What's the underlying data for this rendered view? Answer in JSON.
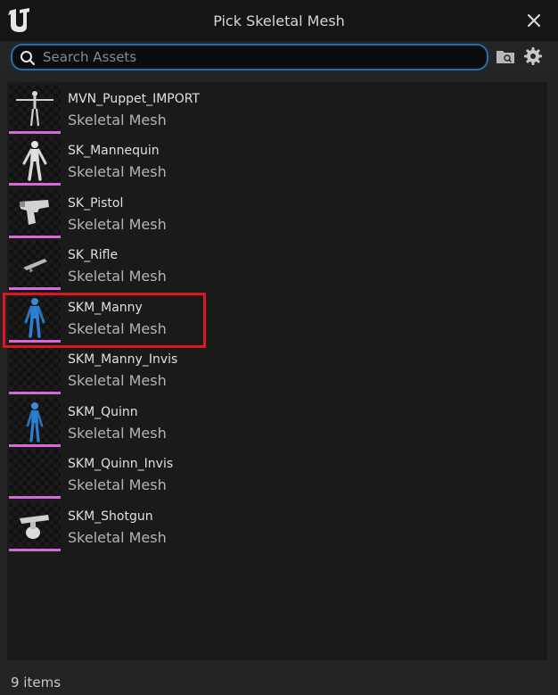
{
  "window": {
    "title": "Pick Skeletal Mesh"
  },
  "search": {
    "placeholder": "Search Assets",
    "value": ""
  },
  "assets": [
    {
      "name": "MVN_Puppet_IMPORT",
      "type": "Skeletal Mesh",
      "thumbnail": "puppet-icon"
    },
    {
      "name": "SK_Mannequin",
      "type": "Skeletal Mesh",
      "thumbnail": "mannequin-icon"
    },
    {
      "name": "SK_Pistol",
      "type": "Skeletal Mesh",
      "thumbnail": "pistol-icon"
    },
    {
      "name": "SK_Rifle",
      "type": "Skeletal Mesh",
      "thumbnail": "rifle-icon"
    },
    {
      "name": "SKM_Manny",
      "type": "Skeletal Mesh",
      "thumbnail": "manny-icon",
      "highlighted": true
    },
    {
      "name": "SKM_Manny_Invis",
      "type": "Skeletal Mesh",
      "thumbnail": "empty"
    },
    {
      "name": "SKM_Quinn",
      "type": "Skeletal Mesh",
      "thumbnail": "quinn-icon"
    },
    {
      "name": "SKM_Quinn_Invis",
      "type": "Skeletal Mesh",
      "thumbnail": "empty"
    },
    {
      "name": "SKM_Shotgun",
      "type": "Skeletal Mesh",
      "thumbnail": "shotgun-icon"
    }
  ],
  "status": {
    "item_count": "9 items"
  },
  "colors": {
    "asset_type_bar": "#d36ad6",
    "search_border": "#1e6fb5",
    "highlight": "#e0161e"
  }
}
